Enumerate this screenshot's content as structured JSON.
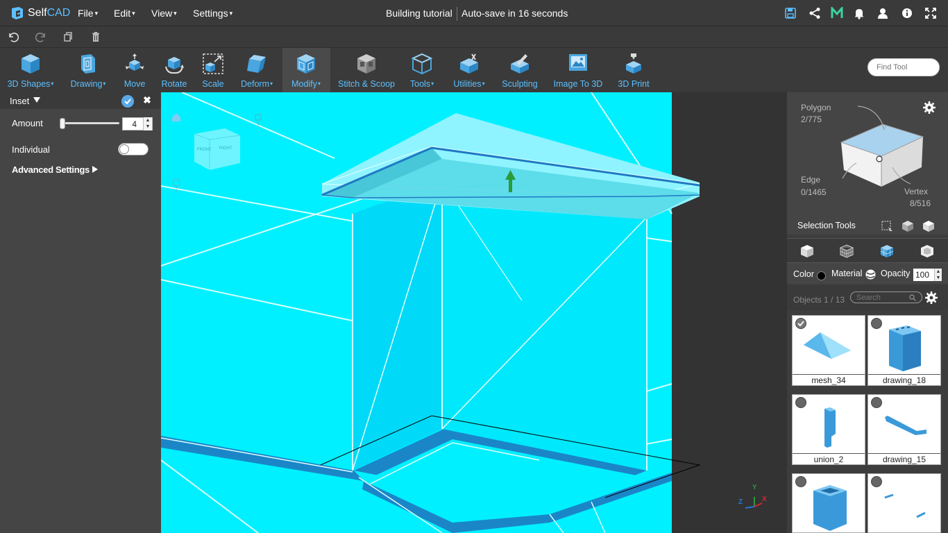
{
  "app": {
    "logo_prefix": "Self",
    "logo_suffix": "CAD"
  },
  "menu": {
    "file": "File",
    "edit": "Edit",
    "view": "View",
    "settings": "Settings"
  },
  "document": {
    "title": "Building tutorial",
    "autosave": "Auto-save in 16 seconds"
  },
  "top_icons": [
    "save-icon",
    "share-icon",
    "m-brand-icon",
    "bell-icon",
    "user-icon",
    "info-icon",
    "fullscreen-icon"
  ],
  "undo_bar": [
    "undo-icon",
    "redo-icon",
    "copy-icon",
    "trash-icon"
  ],
  "toolbar": {
    "shapes": "3D Shapes",
    "drawing": "Drawing",
    "move": "Move",
    "rotate": "Rotate",
    "scale": "Scale",
    "deform": "Deform",
    "modify": "Modify",
    "stitch": "Stitch & Scoop",
    "tools": "Tools",
    "utilities": "Utilities",
    "sculpting": "Sculpting",
    "image3d": "Image To 3D",
    "print3d": "3D Print",
    "find_placeholder": "Find Tool"
  },
  "inset_panel": {
    "title": "Inset",
    "amount_label": "Amount",
    "amount_value": "4",
    "amount_slider_fraction": 0.0,
    "individual_label": "Individual",
    "individual_on": false,
    "advanced_label": "Advanced Settings"
  },
  "viewport": {
    "cube_faces": {
      "front": "FRONT",
      "right": "RIGHT"
    },
    "axes": {
      "x": "X",
      "y": "Y",
      "z": "Z"
    }
  },
  "selection": {
    "polygon_label": "Polygon",
    "polygon_count": "2/775",
    "edge_label": "Edge",
    "edge_count": "0/1465",
    "vertex_label": "Vertex",
    "vertex_count": "8/516",
    "tools_label": "Selection Tools"
  },
  "properties": {
    "color_label": "Color",
    "material_label": "Material",
    "opacity_label": "Opacity",
    "opacity_value": "100"
  },
  "objects": {
    "label": "Objects 1 / 13",
    "search_placeholder": "Search",
    "items": [
      {
        "name": "mesh_34",
        "checked": true
      },
      {
        "name": "drawing_18",
        "checked": false
      },
      {
        "name": "union_2",
        "checked": false
      },
      {
        "name": "drawing_15",
        "checked": false
      },
      {
        "name": "",
        "checked": false
      },
      {
        "name": "",
        "checked": false
      }
    ]
  },
  "colors": {
    "accent": "#5cc0ff",
    "viewport_cyan": "#00f0ff",
    "object_blue": "#3a9ad9"
  }
}
